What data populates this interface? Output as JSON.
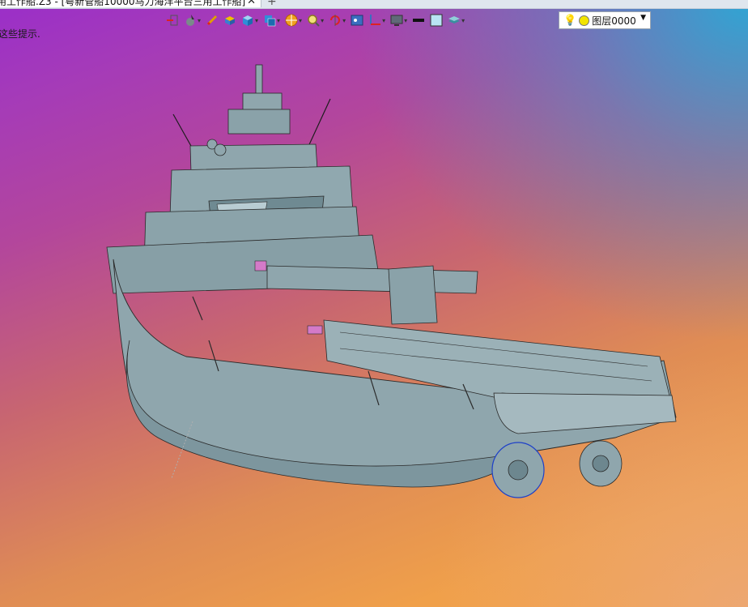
{
  "document_tab": {
    "title": "用工作船.Z3 - [粤新管船10000马力海洋平台三用工作船]",
    "close_icon": "close-icon",
    "new_tab_icon": "plus-icon"
  },
  "toolbar": {
    "buttons": [
      {
        "icon": "exit-icon"
      },
      {
        "icon": "pointer-select-icon",
        "dropdown": true
      },
      {
        "icon": "sketch-pen-icon"
      },
      {
        "icon": "shaded-box-icon"
      },
      {
        "icon": "solid-cube-icon",
        "dropdown": true
      },
      {
        "icon": "view-cube-icon",
        "dropdown": true
      },
      {
        "icon": "render-sphere-icon",
        "dropdown": true
      },
      {
        "icon": "zoom-icon",
        "dropdown": true
      },
      {
        "icon": "pan-rotate-icon",
        "dropdown": true
      },
      {
        "icon": "section-view-icon"
      },
      {
        "icon": "axis-icon",
        "dropdown": true
      },
      {
        "icon": "display-monitor-icon",
        "dropdown": true
      },
      {
        "icon": "line-style-icon"
      },
      {
        "icon": "color-fill-icon"
      },
      {
        "icon": "layers-icon",
        "dropdown": true
      }
    ]
  },
  "layer_combo": {
    "bulb_icon": "light-bulb-icon",
    "value": "图层0000",
    "dot_color": "#f2e400"
  },
  "hint": {
    "text": "这些提示."
  },
  "viewport": {
    "model": "ship-3d-model"
  },
  "colors": {
    "hull": "#8fa6ad",
    "hull_dark": "#5f7880",
    "deck_accent": "#d47ac8"
  }
}
